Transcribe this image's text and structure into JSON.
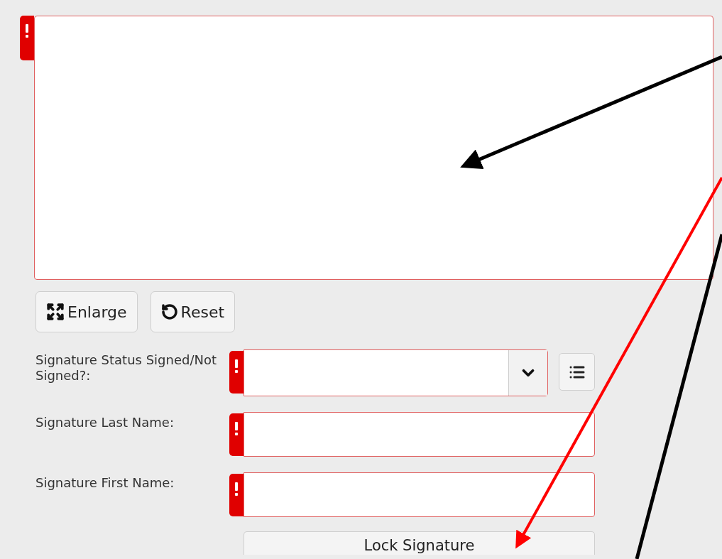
{
  "signature_pad": {
    "required": true
  },
  "pad_buttons": [
    {
      "kind": "enlarge",
      "label": "Enlarge"
    },
    {
      "kind": "reset",
      "label": "Reset"
    }
  ],
  "fields": [
    {
      "kind": "select",
      "label": "Signature Status Signed/Not Signed?:",
      "required": true
    },
    {
      "kind": "text",
      "label": "Signature Last Name:",
      "required": true
    },
    {
      "kind": "text",
      "label": "Signature First Name:",
      "required": true
    }
  ],
  "lock_button": {
    "label": "Lock Signature"
  }
}
